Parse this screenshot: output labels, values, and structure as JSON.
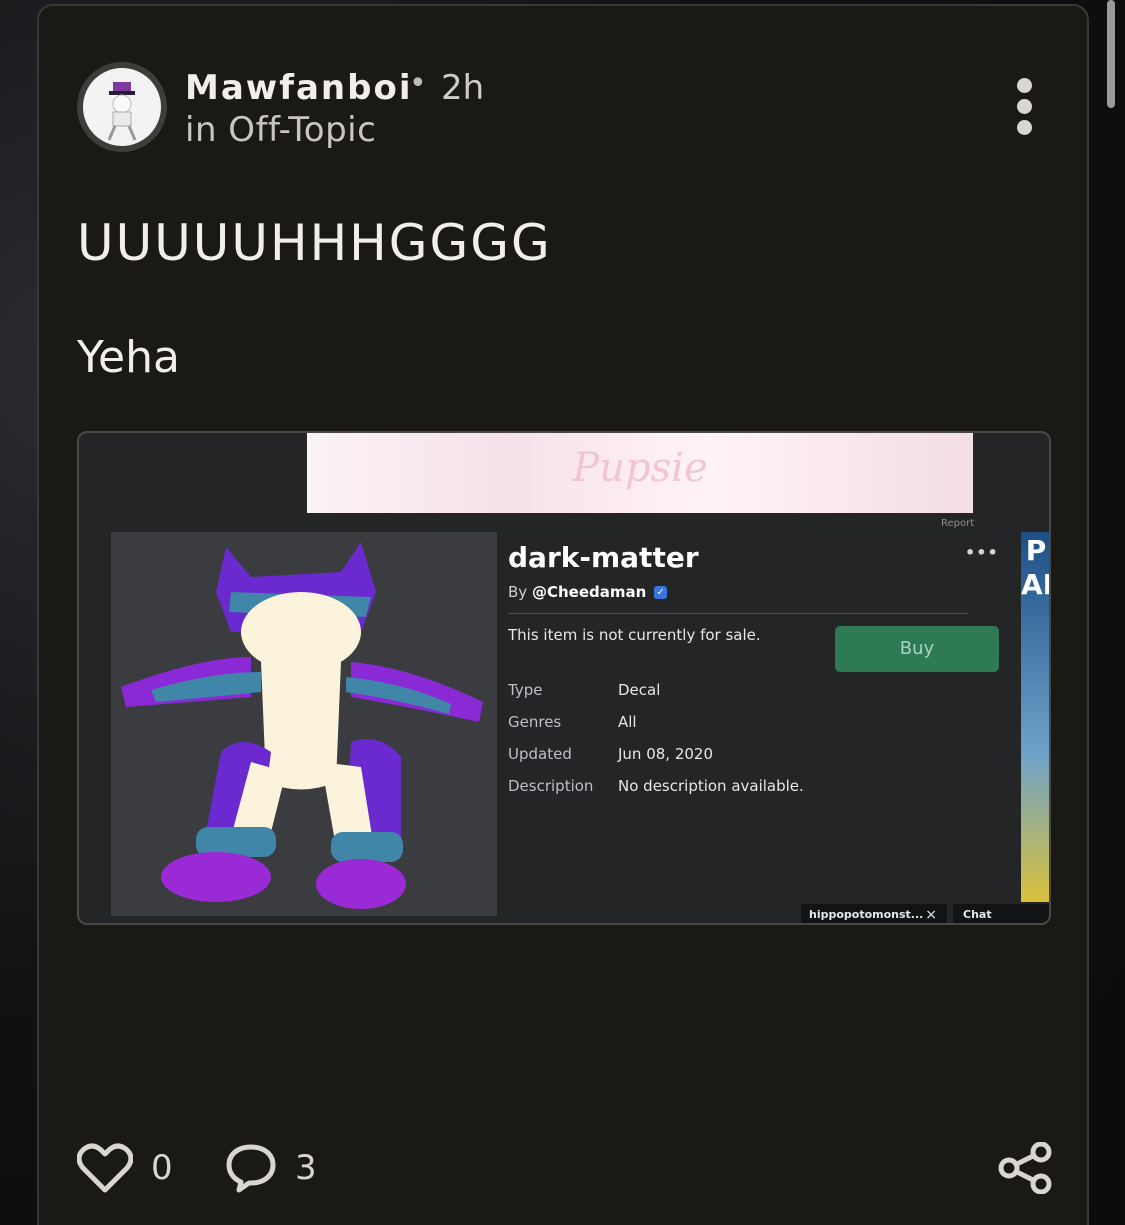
{
  "post": {
    "username": "Mawfanboi",
    "separator": "•",
    "time": "2h",
    "category": "in Off-Topic",
    "title": "UUUUUHHHGGGG",
    "body": "Yeha"
  },
  "embed": {
    "banner_text": "Pupsie",
    "report_label": "Report",
    "item_name": "dark-matter",
    "more_label": "•••",
    "by_prefix": "By",
    "creator": "@Cheedaman",
    "verified_mark": "✓",
    "sale_status": "This item is not currently for sale.",
    "buy_label": "Buy",
    "details": [
      {
        "key": "Type",
        "value": "Decal"
      },
      {
        "key": "Genres",
        "value": "All"
      },
      {
        "key": "Updated",
        "value": "Jun 08, 2020"
      },
      {
        "key": "Description",
        "value": "No description available."
      }
    ],
    "side_text": "P\nAI",
    "chat_tab_user": "hippopotomonst...",
    "chat_tab_close": "×",
    "chat_tab_chat": "Chat"
  },
  "actions": {
    "likes": "0",
    "comments": "3"
  },
  "icons": {
    "more": "more-vertical-icon",
    "like": "heart-icon",
    "comment": "comment-bubble-icon",
    "share": "share-icon"
  },
  "colors": {
    "card_bg": "#1b1916",
    "buy_button": "#2e7a54",
    "verified": "#3a74e0"
  }
}
